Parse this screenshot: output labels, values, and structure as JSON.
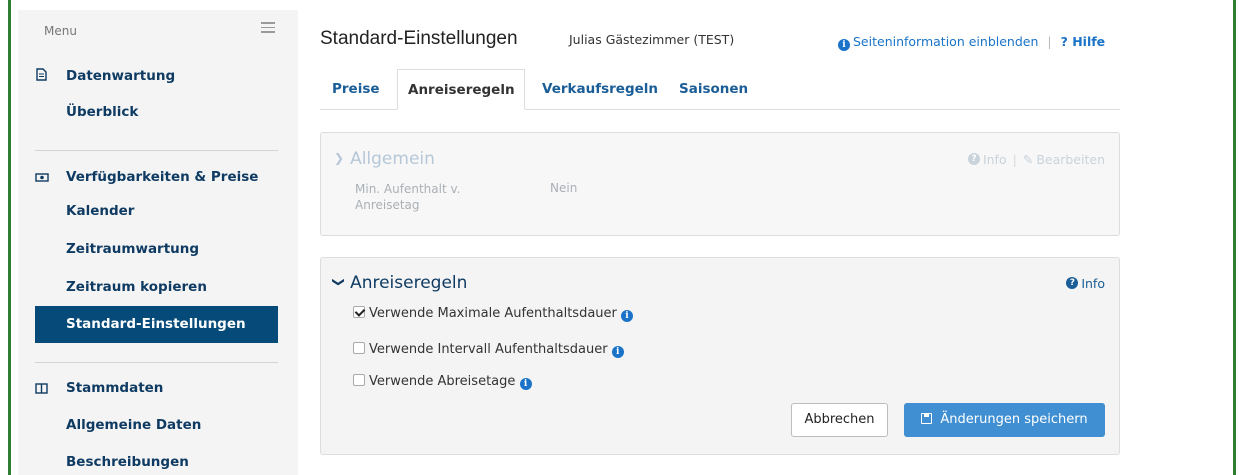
{
  "sidebar": {
    "menu_label": "Menu",
    "sections": [
      {
        "title": "Datenwartung",
        "icon": "document-icon",
        "items": [
          "Überblick"
        ]
      },
      {
        "title": "Verfügbarkeiten & Preise",
        "icon": "money-icon",
        "items": [
          "Kalender",
          "Zeitraumwartung",
          "Zeitraum kopieren",
          "Standard-Einstellungen"
        ]
      },
      {
        "title": "Stammdaten",
        "icon": "columns-icon",
        "items": [
          "Allgemeine Daten",
          "Beschreibungen"
        ]
      }
    ],
    "active_item": "Standard-Einstellungen"
  },
  "header": {
    "title": "Standard-Einstellungen",
    "subtitle": "Julias Gästezimmer (TEST)",
    "info_link": "Seiteninformation einblenden",
    "separator": "|",
    "help_link": "? Hilfe"
  },
  "tabs": [
    {
      "label": "Preise",
      "active": false
    },
    {
      "label": "Anreiseregeln",
      "active": true
    },
    {
      "label": "Verkaufsregeln",
      "active": false
    },
    {
      "label": "Saisonen",
      "active": false
    }
  ],
  "panel_allgemein": {
    "title": "Allgemein",
    "info": "Info",
    "separator": "|",
    "edit": "Bearbeiten",
    "field_label": "Min. Aufenthalt v. Anreisetag",
    "field_value": "Nein"
  },
  "panel_anreiseregeln": {
    "title": "Anreiseregeln",
    "info": "Info",
    "checkboxes": [
      {
        "label": "Verwende Maximale Aufenthaltsdauer",
        "checked": true
      },
      {
        "label": "Verwende Intervall Aufenthaltsdauer",
        "checked": false
      },
      {
        "label": "Verwende Abreisetage",
        "checked": false
      }
    ],
    "cancel_button": "Abbrechen",
    "save_button": "Änderungen speichern"
  },
  "colors": {
    "accent": "#064a7a",
    "link": "#1a73c8",
    "save_button": "#3f8fd2",
    "frame_green": "#2e7d32"
  }
}
